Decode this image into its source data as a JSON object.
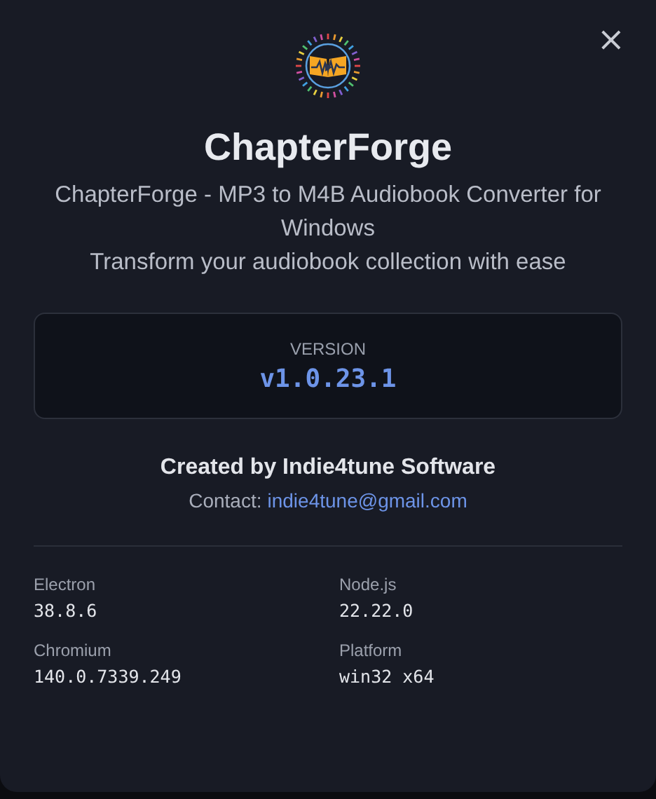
{
  "dialog": {
    "close": "×",
    "app_name": "ChapterForge",
    "description": [
      "ChapterForge - MP3 to M4B Audiobook Converter for Windows",
      "Transform your audiobook collection with ease"
    ],
    "version": {
      "label": "VERSION",
      "value": "v1.0.23.1"
    },
    "credits": {
      "author": "Created by Indie4tune Software",
      "contact_label": "Contact:",
      "contact_email": "indie4tune@gmail.com"
    },
    "details": [
      {
        "label": "Electron",
        "value": "38.8.6"
      },
      {
        "label": "Node.js",
        "value": "22.22.0"
      },
      {
        "label": "Chromium",
        "value": "140.0.7339.249"
      },
      {
        "label": "Platform",
        "value": "win32 x64"
      }
    ]
  }
}
